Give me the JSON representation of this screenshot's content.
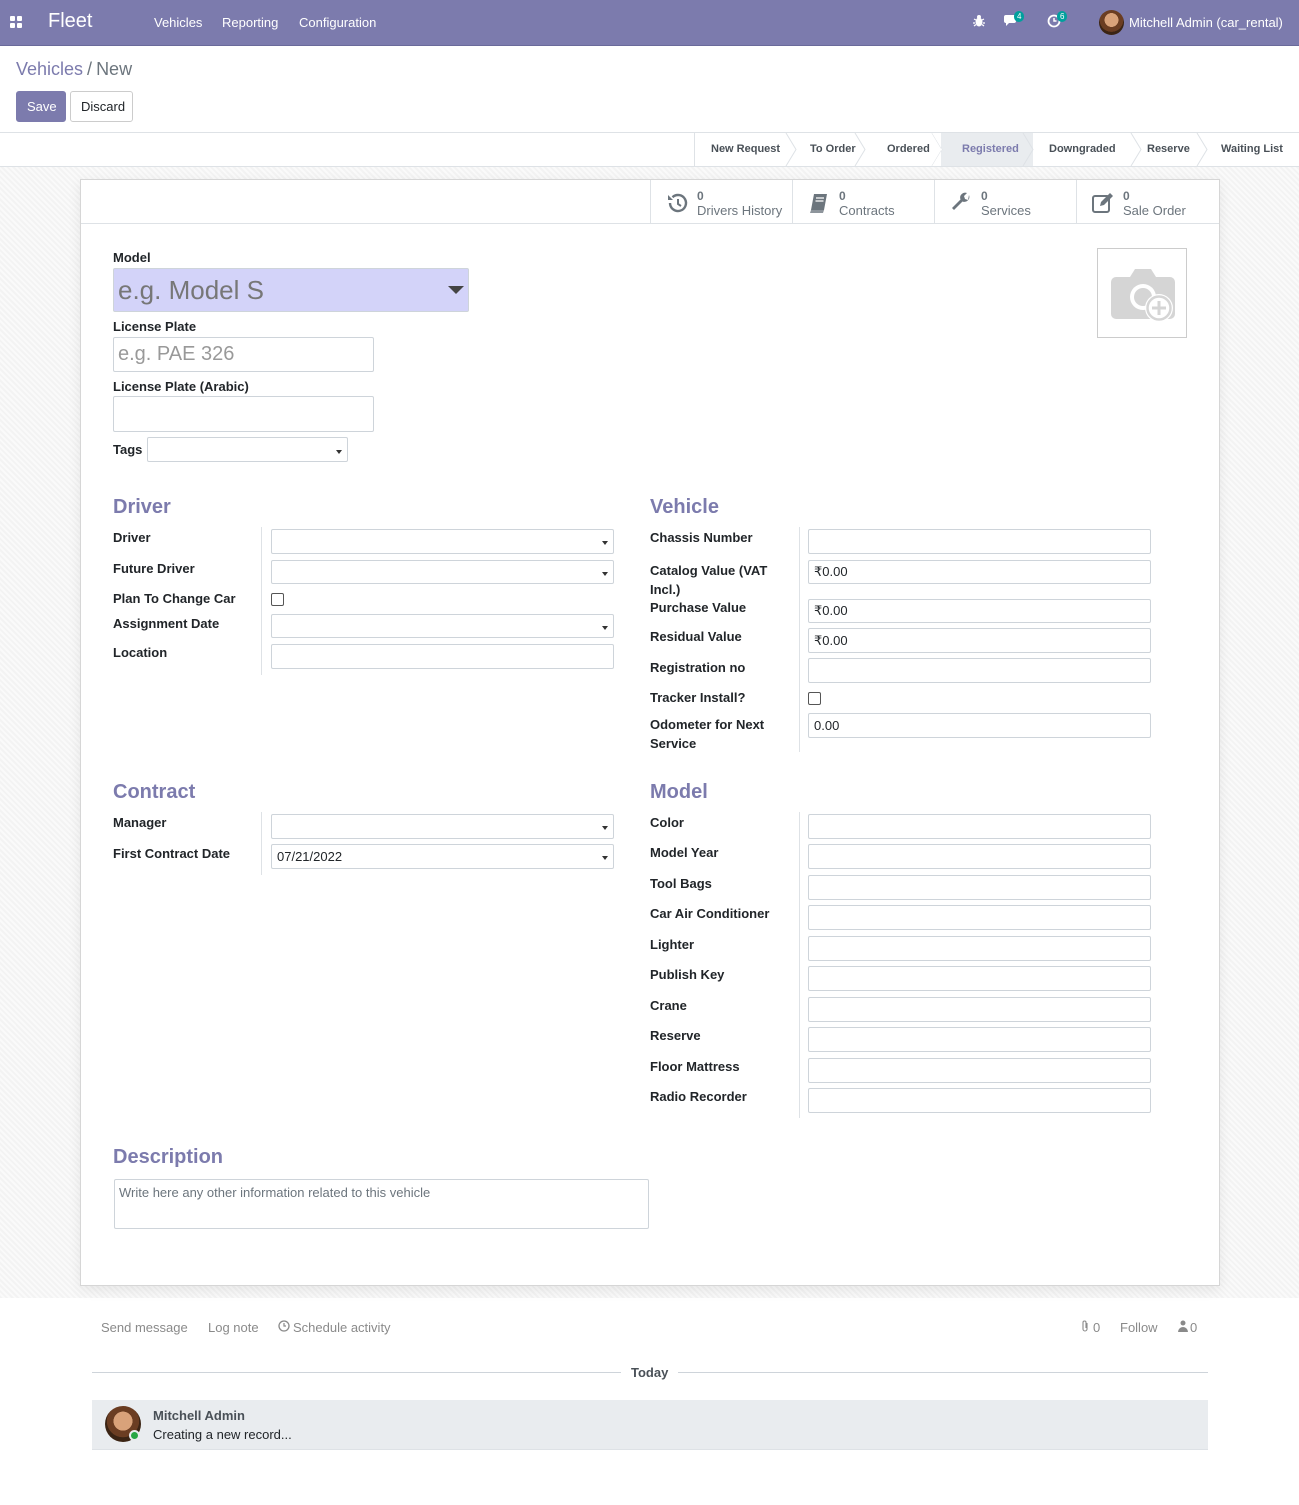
{
  "navbar": {
    "brand": "Fleet",
    "menus": [
      "Vehicles",
      "Reporting",
      "Configuration"
    ],
    "messages_count": "4",
    "activities_count": "6",
    "user": "Mitchell Admin (car_rental)"
  },
  "breadcrumb": {
    "parent": "Vehicles",
    "sep": "/",
    "current": "New"
  },
  "actions": {
    "save": "Save",
    "discard": "Discard"
  },
  "stages": [
    "New Request",
    "To Order",
    "Ordered",
    "Registered",
    "Downgraded",
    "Reserve",
    "Waiting List"
  ],
  "active_stage": "Registered",
  "smart_buttons": [
    {
      "count": "0",
      "label": "Drivers History",
      "icon": "history-icon"
    },
    {
      "count": "0",
      "label": "Contracts",
      "icon": "book-icon"
    },
    {
      "count": "0",
      "label": "Services",
      "icon": "wrench-icon"
    },
    {
      "count": "0",
      "label": "Sale Order",
      "icon": "edit-icon"
    }
  ],
  "header": {
    "model_label": "Model",
    "model_placeholder": "e.g. Model S",
    "plate_label": "License Plate",
    "plate_placeholder": "e.g. PAE 326",
    "plate_ar_label": "License Plate (Arabic)",
    "tags_label": "Tags"
  },
  "driver": {
    "title": "Driver",
    "driver": "Driver",
    "future_driver": "Future Driver",
    "plan_change": "Plan To Change Car",
    "assignment_date": "Assignment Date",
    "location": "Location"
  },
  "vehicle": {
    "title": "Vehicle",
    "chassis": "Chassis Number",
    "catalog": "Catalog Value (VAT Incl.)",
    "catalog_value": "₹0.00",
    "purchase": "Purchase Value",
    "purchase_value": "₹0.00",
    "residual": "Residual Value",
    "residual_value": "₹0.00",
    "registration": "Registration no",
    "tracker": "Tracker Install?",
    "odometer": "Odometer for Next Service",
    "odometer_value": "0.00"
  },
  "contract": {
    "title": "Contract",
    "manager": "Manager",
    "first_date": "First Contract Date",
    "first_date_value": "07/21/2022"
  },
  "model_section": {
    "title": "Model",
    "fields": [
      "Color",
      "Model Year",
      "Tool Bags",
      "Car Air Conditioner",
      "Lighter",
      "Publish Key",
      "Crane",
      "Reserve",
      "Floor Mattress",
      "Radio Recorder"
    ]
  },
  "description": {
    "title": "Description",
    "placeholder": "Write here any other information related to this vehicle"
  },
  "chatter": {
    "send": "Send message",
    "log": "Log note",
    "schedule": "Schedule activity",
    "attachments": "0",
    "follow": "Follow",
    "followers": "0",
    "today": "Today",
    "author": "Mitchell Admin",
    "body": "Creating a new record..."
  },
  "colors": {
    "primary": "#7c7bad",
    "badge": "#00a09d"
  }
}
